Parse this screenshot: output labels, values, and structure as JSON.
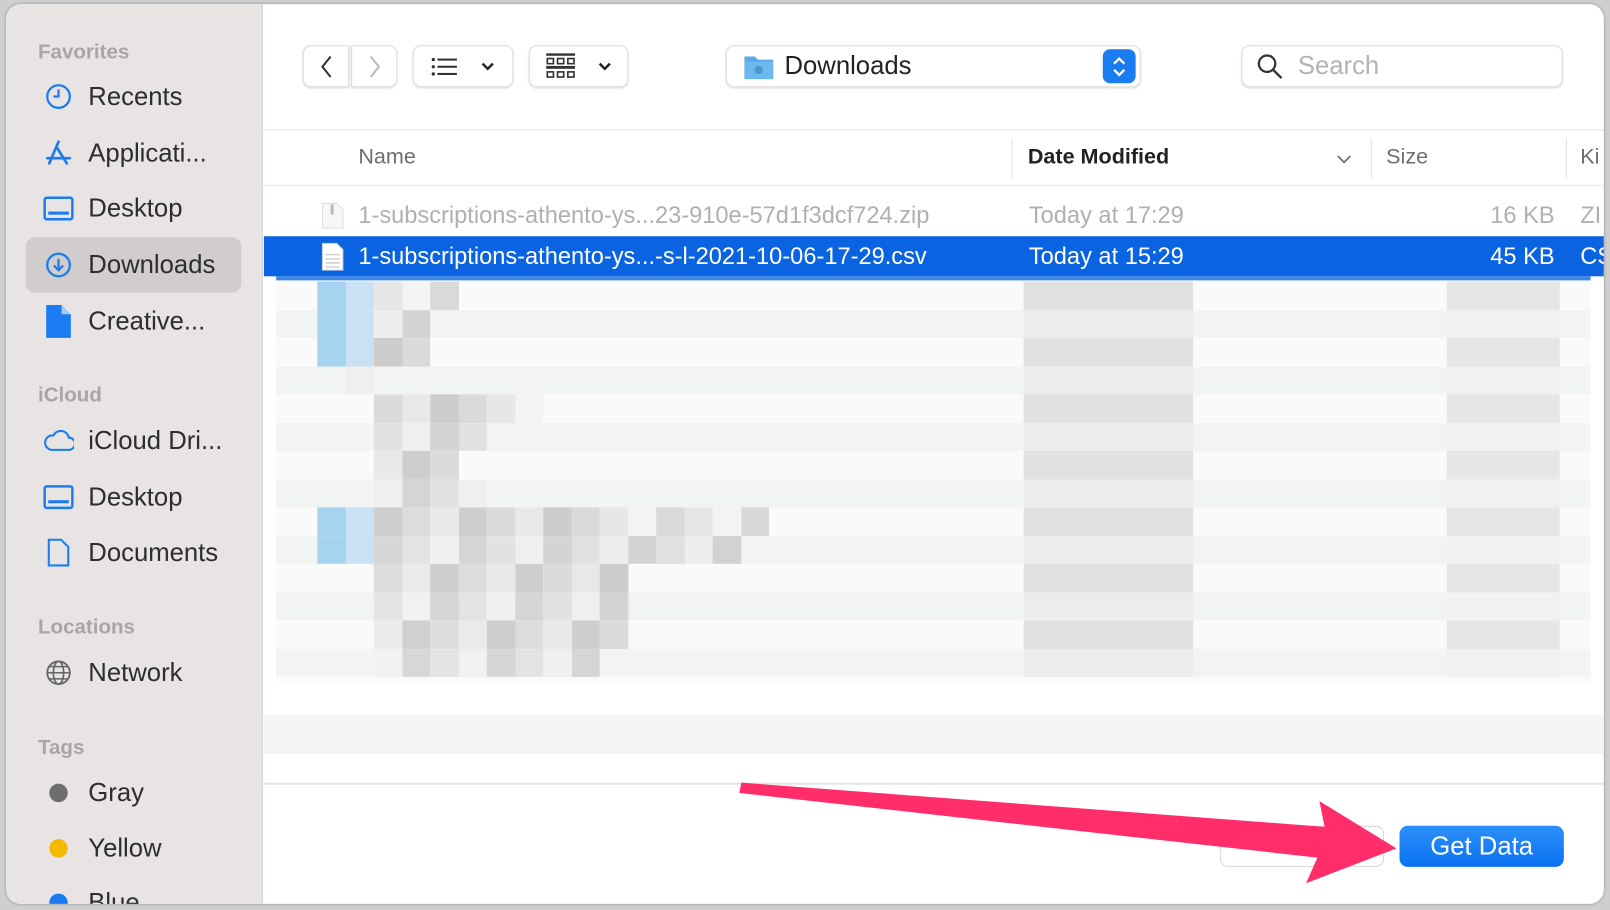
{
  "sidebar": {
    "favorites_label": "Favorites",
    "favorites": [
      {
        "label": "Recents",
        "icon": "clock-icon"
      },
      {
        "label": "Applicati...",
        "icon": "app-store-icon"
      },
      {
        "label": "Desktop",
        "icon": "desktop-icon"
      },
      {
        "label": "Downloads",
        "icon": "download-icon",
        "selected": true
      },
      {
        "label": "Creative...",
        "icon": "document-icon"
      }
    ],
    "icloud_label": "iCloud",
    "icloud": [
      {
        "label": "iCloud Dri...",
        "icon": "cloud-icon"
      },
      {
        "label": "Desktop",
        "icon": "desktop-icon"
      },
      {
        "label": "Documents",
        "icon": "document-icon"
      }
    ],
    "locations_label": "Locations",
    "locations": [
      {
        "label": "Network",
        "icon": "globe-icon"
      }
    ],
    "tags_label": "Tags",
    "tags": [
      {
        "label": "Gray",
        "color": "#6e6e6e"
      },
      {
        "label": "Yellow",
        "color": "#f5b800"
      },
      {
        "label": "Blue",
        "color": "#1a7cf0"
      }
    ]
  },
  "toolbar": {
    "location": "Downloads",
    "search_placeholder": "Search"
  },
  "columns": {
    "name": "Name",
    "date": "Date Modified",
    "size": "Size",
    "kind": "Ki"
  },
  "files": [
    {
      "name": "1-subscriptions-athento-ys...23-910e-57d1f3dcf724.zip",
      "date": "Today at 17:29",
      "size": "16 KB",
      "kind": "ZI",
      "dimmed": true
    },
    {
      "name": "1-subscriptions-athento-ys...-s-l-2021-10-06-17-29.csv",
      "date": "Today at 15:29",
      "size": "45 KB",
      "kind": "CS",
      "selected": true
    }
  ],
  "footer": {
    "primary": "Get Data",
    "secondary": ""
  },
  "colors": {
    "accent": "#0a63e0",
    "annotation_arrow": "#ff2d6a"
  }
}
